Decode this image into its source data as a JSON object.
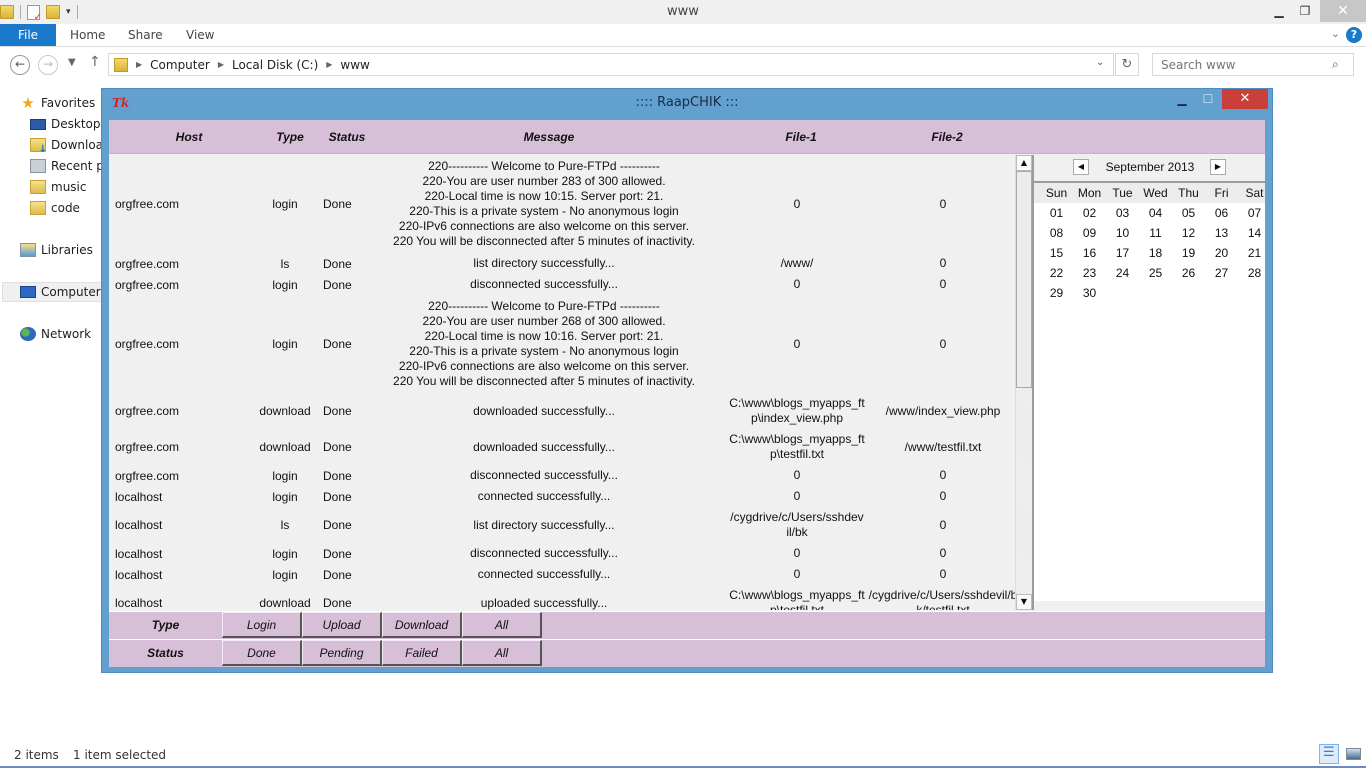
{
  "explorer": {
    "window_title": "www",
    "ribbon_tabs": [
      "File",
      "Home",
      "Share",
      "View"
    ],
    "breadcrumb": [
      "Computer",
      "Local Disk (C:)",
      "www"
    ],
    "search_placeholder": "Search www",
    "nav_pane": [
      {
        "label": "Favorites",
        "icon": "star-icon"
      },
      {
        "label": "Desktop",
        "icon": "desktop-icon"
      },
      {
        "label": "Downloads",
        "icon": "downloads-folder-icon"
      },
      {
        "label": "Recent places",
        "icon": "recent-places-icon"
      },
      {
        "label": "music",
        "icon": "folder-icon"
      },
      {
        "label": "code",
        "icon": "folder-icon"
      },
      {
        "label": "Libraries",
        "icon": "libraries-icon"
      },
      {
        "label": "Computer",
        "icon": "computer-icon",
        "selected": true
      },
      {
        "label": "Network",
        "icon": "network-icon"
      }
    ],
    "status": {
      "item_count": "2 items",
      "selection": "1 item selected"
    }
  },
  "app": {
    "title": ":::: RaapCHIK :::",
    "logo": "Tk",
    "columns": [
      "Host",
      "Type",
      "Status",
      "Message",
      "File-1",
      "File-2"
    ],
    "rows": [
      {
        "host": "orgfree.com",
        "type": "login",
        "status": "Done",
        "message": [
          "220---------- Welcome to Pure-FTPd ----------",
          "220-You are user number 283 of 300 allowed.",
          "220-Local time is now 10:15. Server port: 21.",
          "220-This is a private system - No anonymous login",
          "220-IPv6 connections are also welcome on this server.",
          "220 You will be disconnected after 5 minutes of inactivity."
        ],
        "file1": "0",
        "file2": "0"
      },
      {
        "host": "orgfree.com",
        "type": "ls",
        "status": "Done",
        "message": [
          "list directory successfully..."
        ],
        "file1": "/www/",
        "file2": "0"
      },
      {
        "host": "orgfree.com",
        "type": "login",
        "status": "Done",
        "message": [
          "disconnected successfully..."
        ],
        "file1": "0",
        "file2": "0"
      },
      {
        "host": "orgfree.com",
        "type": "login",
        "status": "Done",
        "message": [
          "220---------- Welcome to Pure-FTPd ----------",
          "220-You are user number 268 of 300 allowed.",
          "220-Local time is now 10:16. Server port: 21.",
          "220-This is a private system - No anonymous login",
          "220-IPv6 connections are also welcome on this server.",
          "220 You will be disconnected after 5 minutes of inactivity."
        ],
        "file1": "0",
        "file2": "0"
      },
      {
        "host": "orgfree.com",
        "type": "download",
        "status": "Done",
        "message": [
          "downloaded successfully..."
        ],
        "file1": "C:\\www\\blogs_myapps_ftp\\index_view.php",
        "file2": "/www/index_view.php"
      },
      {
        "host": "orgfree.com",
        "type": "download",
        "status": "Done",
        "message": [
          "downloaded successfully..."
        ],
        "file1": "C:\\www\\blogs_myapps_ftp\\testfil.txt",
        "file2": "/www/testfil.txt"
      },
      {
        "host": "orgfree.com",
        "type": "login",
        "status": "Done",
        "message": [
          "disconnected successfully..."
        ],
        "file1": "0",
        "file2": "0"
      },
      {
        "host": "localhost",
        "type": "login",
        "status": "Done",
        "message": [
          "connected successfully..."
        ],
        "file1": "0",
        "file2": "0"
      },
      {
        "host": "localhost",
        "type": "ls",
        "status": "Done",
        "message": [
          "list directory successfully..."
        ],
        "file1": "/cygdrive/c/Users/sshdevil/bk",
        "file2": "0"
      },
      {
        "host": "localhost",
        "type": "login",
        "status": "Done",
        "message": [
          "disconnected successfully..."
        ],
        "file1": "0",
        "file2": "0"
      },
      {
        "host": "localhost",
        "type": "login",
        "status": "Done",
        "message": [
          "connected successfully..."
        ],
        "file1": "0",
        "file2": "0"
      },
      {
        "host": "localhost",
        "type": "download",
        "status": "Done",
        "message": [
          "uploaded successfully..."
        ],
        "file1": "C:\\www\\blogs_myapps_ftp\\testfil.txt",
        "file2": "/cygdrive/c/Users/sshdevil/bk/testfil.txt"
      }
    ],
    "calendar": {
      "month_label": "September 2013",
      "weekdays": [
        "Sun",
        "Mon",
        "Tue",
        "Wed",
        "Thu",
        "Fri",
        "Sat"
      ],
      "first_weekday_index": 0,
      "days": [
        "01",
        "02",
        "03",
        "04",
        "05",
        "06",
        "07",
        "08",
        "09",
        "10",
        "11",
        "12",
        "13",
        "14",
        "15",
        "16",
        "17",
        "18",
        "19",
        "20",
        "21",
        "22",
        "23",
        "24",
        "25",
        "26",
        "27",
        "28",
        "29",
        "30"
      ]
    },
    "filters": {
      "type": {
        "label": "Type",
        "options": [
          "Login",
          "Upload",
          "Download",
          "All"
        ]
      },
      "status": {
        "label": "Status",
        "options": [
          "Done",
          "Pending",
          "Failed",
          "All"
        ]
      }
    }
  }
}
